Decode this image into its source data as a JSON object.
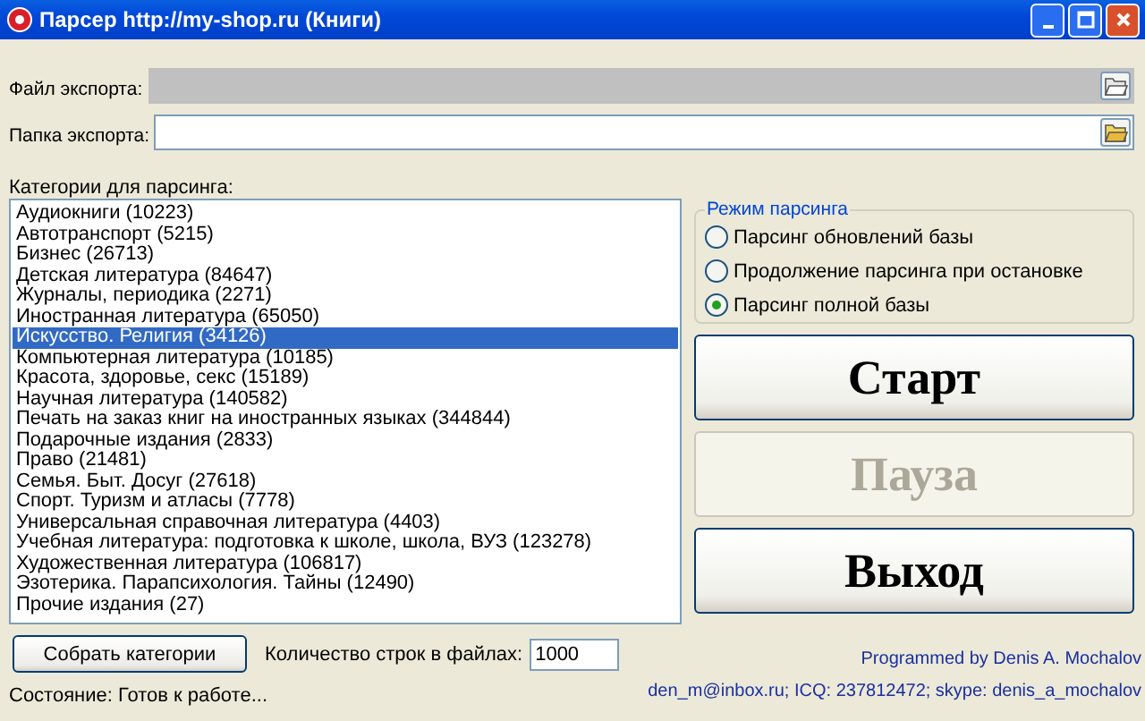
{
  "window": {
    "title": "Парсер http://my-shop.ru (Книги)"
  },
  "fields": [
    {
      "label": "Файл экспорта:",
      "disabled": true
    },
    {
      "label": "Папка экспорта:",
      "disabled": false
    }
  ],
  "categories": {
    "label": "Категории для парсинга:",
    "items": [
      {
        "text": "Аудиокниги (10223)",
        "selected": false
      },
      {
        "text": "Автотранспорт (5215)",
        "selected": false
      },
      {
        "text": "Бизнес (26713)",
        "selected": false
      },
      {
        "text": "Детская литература (84647)",
        "selected": false
      },
      {
        "text": "Журналы, периодика (2271)",
        "selected": false
      },
      {
        "text": "Иностранная литература (65050)",
        "selected": false
      },
      {
        "text": "Искусство. Религия (34126)",
        "selected": true
      },
      {
        "text": "Компьютерная литература (10185)",
        "selected": false
      },
      {
        "text": "Красота, здоровье, секс (15189)",
        "selected": false
      },
      {
        "text": "Научная литература (140582)",
        "selected": false
      },
      {
        "text": "Печать на заказ книг на иностранных языках (344844)",
        "selected": false
      },
      {
        "text": "Подарочные издания (2833)",
        "selected": false
      },
      {
        "text": "Право (21481)",
        "selected": false
      },
      {
        "text": "Семья. Быт. Досуг (27618)",
        "selected": false
      },
      {
        "text": "Спорт. Туризм и атласы (7778)",
        "selected": false
      },
      {
        "text": "Универсальная справочная литература (4403)",
        "selected": false
      },
      {
        "text": "Учебная литература: подготовка к школе, школа, ВУЗ (123278)",
        "selected": false
      },
      {
        "text": "Художественная литература (106817)",
        "selected": false
      },
      {
        "text": "Эзотерика. Парапсихология. Тайны (12490)",
        "selected": false
      },
      {
        "text": "Прочие издания (27)",
        "selected": false
      }
    ]
  },
  "mode": {
    "title": "Режим парсинга",
    "options": [
      {
        "label": "Парсинг обновлений базы",
        "selected": false
      },
      {
        "label": "Продолжение парсинга при остановке",
        "selected": false
      },
      {
        "label": "Парсинг полной базы",
        "selected": true
      }
    ]
  },
  "actions": [
    {
      "label": "Старт",
      "disabled": false
    },
    {
      "label": "Пауза",
      "disabled": true
    },
    {
      "label": "Выход",
      "disabled": false
    }
  ],
  "collect_button": "Собрать категории",
  "rows_count": {
    "label": "Количество строк в файлах:",
    "value": "1000"
  },
  "status": "Состояние: Готов к работе...",
  "credits": [
    "Programmed by Denis A. Mochalov",
    "den_m@inbox.ru; ICQ: 237812472; skype: denis_a_mochalov"
  ]
}
